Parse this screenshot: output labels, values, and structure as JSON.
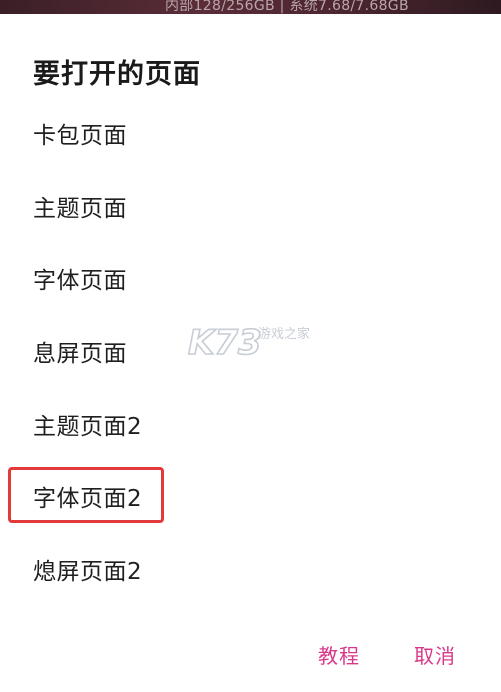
{
  "status_bar": {
    "storage_text": "内部128/256GB | 系统7.68/7.68GB"
  },
  "dialog": {
    "title": "要打开的页面",
    "options": [
      {
        "label": "卡包页面"
      },
      {
        "label": "主题页面"
      },
      {
        "label": "字体页面"
      },
      {
        "label": "息屏页面"
      },
      {
        "label": "主题页面2"
      },
      {
        "label": "字体页面2",
        "highlighted": true
      },
      {
        "label": "熄屏页面2"
      }
    ],
    "buttons": {
      "tutorial": "教程",
      "cancel": "取消"
    }
  },
  "watermark": {
    "logo_text": "K73",
    "sub_text": "游戏之家"
  },
  "colors": {
    "accent": "#d9388a",
    "highlight_border": "#e23a3a",
    "watermark": "#9aa6b2"
  }
}
